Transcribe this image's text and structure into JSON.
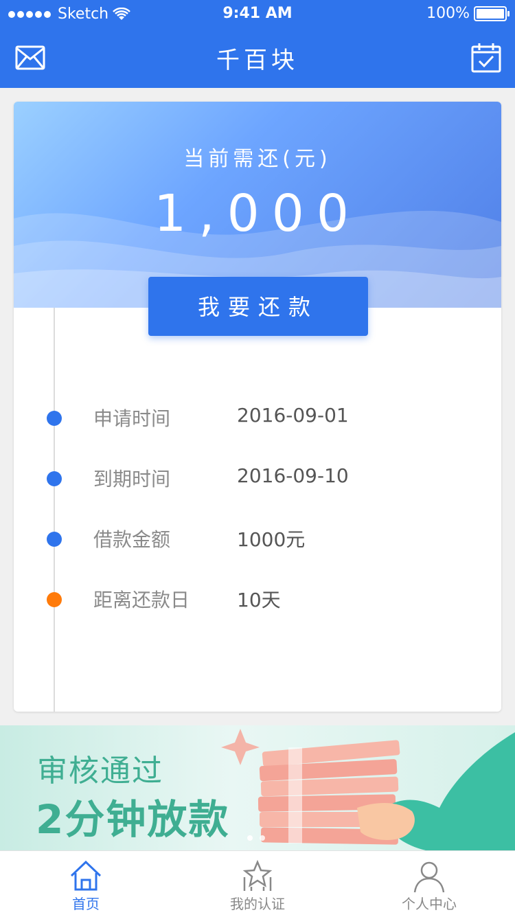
{
  "status_bar": {
    "carrier": "Sketch",
    "time": "9:41 AM",
    "battery": "100%"
  },
  "header": {
    "title": "千百块",
    "left_icon": "mail-icon",
    "right_icon": "calendar-check-icon"
  },
  "summary": {
    "label": "当前需还(元)",
    "amount": "1,000",
    "button_label": "我要还款"
  },
  "details": [
    {
      "key": "申请时间",
      "value": "2016-09-01",
      "dot_color": "#2f74ec"
    },
    {
      "key": "到期时间",
      "value": "2016-09-10",
      "dot_color": "#2f74ec"
    },
    {
      "key": "借款金额",
      "value": "1000元",
      "dot_color": "#2f74ec"
    },
    {
      "key": "距离还款日",
      "value": "10天",
      "dot_color": "#ff7b0a"
    }
  ],
  "promo": {
    "line1": "审核通过",
    "line2": "2分钟放款",
    "page_count": 2,
    "active_page": 1
  },
  "tabbar": {
    "items": [
      {
        "label": "首页",
        "icon": "home-icon",
        "active": true
      },
      {
        "label": "我的认证",
        "icon": "certification-star-icon",
        "active": false
      },
      {
        "label": "个人中心",
        "icon": "user-icon",
        "active": false
      }
    ]
  },
  "colors": {
    "primary": "#2f74ec",
    "accent_orange": "#ff7b0a",
    "promo_green": "#3fae92"
  }
}
